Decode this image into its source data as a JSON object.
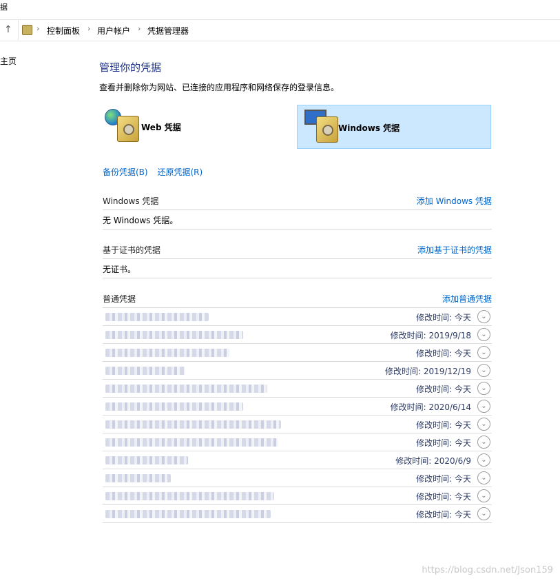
{
  "window": {
    "title_fragment": "据",
    "side_nav_home": "主页"
  },
  "breadcrumb": [
    "控制面板",
    "用户帐户",
    "凭据管理器"
  ],
  "page": {
    "heading": "管理你的凭据",
    "description": "查看并删除你为网站、已连接的应用程序和网络保存的登录信息。"
  },
  "tiles": {
    "web": "Web 凭据",
    "windows": "Windows 凭据"
  },
  "actions": {
    "backup": "备份凭据(B)",
    "restore": "还原凭据(R)"
  },
  "sections": {
    "windows": {
      "title": "Windows 凭据",
      "add": "添加 Windows 凭据",
      "empty": "无 Windows 凭据。"
    },
    "cert": {
      "title": "基于证书的凭据",
      "add": "添加基于证书的凭据",
      "empty": "无证书。"
    },
    "generic": {
      "title": "普通凭据",
      "add": "添加普通凭据"
    }
  },
  "credentials": [
    {
      "modified": "修改时间:  今天"
    },
    {
      "modified": "修改时间:  2019/9/18"
    },
    {
      "modified": "修改时间:  今天"
    },
    {
      "modified": "修改时间:  2019/12/19"
    },
    {
      "modified": "修改时间:  今天"
    },
    {
      "modified": "修改时间:  2020/6/14"
    },
    {
      "modified": "修改时间:  今天"
    },
    {
      "modified": "修改时间:  今天"
    },
    {
      "modified": "修改时间:  2020/6/9"
    },
    {
      "modified": "修改时间:  今天"
    },
    {
      "modified": "修改时间:  今天"
    },
    {
      "modified": "修改时间:  今天"
    }
  ],
  "watermark": "https://blog.csdn.net/Json159",
  "colors": {
    "accent_link": "#0066cc",
    "heading": "#1e3287",
    "selected_tile": "#cce8ff"
  },
  "icons": {
    "up": "up-arrow-icon",
    "control_panel": "control-panel-icon",
    "expand": "chevron-down-circle-icon"
  }
}
